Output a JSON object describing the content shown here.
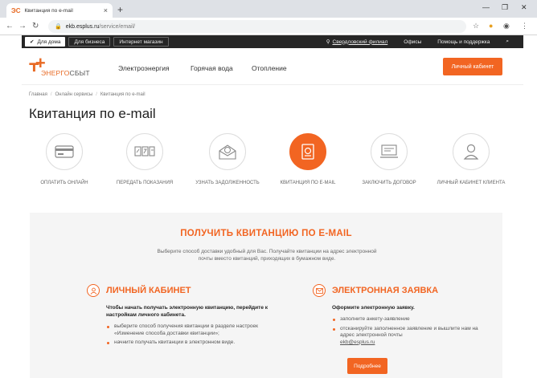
{
  "browser": {
    "tab_title": "Квитанция по e-mail",
    "tab_favicon": "ЭС",
    "url_host": "ekb.esplus.ru",
    "url_path": "/service/email/"
  },
  "topbar": {
    "home": "Для дома",
    "business": "Для бизнеса",
    "shop": "Интернет магазин",
    "branch": "Свердловский филиал",
    "offices": "Офисы",
    "help": "Помощь и поддержка"
  },
  "header": {
    "logo_prefix": "ЭНЕРГО",
    "logo_suffix": "СБЫТ",
    "nav": [
      "Электроэнергия",
      "Горячая вода",
      "Отопление"
    ],
    "cabinet_button": "Личный кабинет"
  },
  "breadcrumbs": [
    "Главная",
    "Онлайн сервисы",
    "Квитанция по e-mail"
  ],
  "page_title": "Квитанция по e-mail",
  "services": [
    {
      "label": "Оплатить онлайн",
      "icon": "card-icon",
      "active": false
    },
    {
      "label": "Передать показания",
      "icon": "meter-icon",
      "active": false
    },
    {
      "label": "Узнать задолженность",
      "icon": "debt-envelope-icon",
      "active": false
    },
    {
      "label": "Квитанция по e-mail",
      "icon": "email-receipt-icon",
      "active": true
    },
    {
      "label": "Заключить договор",
      "icon": "contract-icon",
      "active": false
    },
    {
      "label": "Личный кабинет клиента",
      "icon": "user-icon",
      "active": false
    }
  ],
  "panel": {
    "title": "ПОЛУЧИТЬ КВИТАНЦИЮ ПО E-MAIL",
    "description": "Выберите способ доставки удобный для Вас. Получайте квитанции на адрес электронной почты вместо квитанций, приходящих в бумажном виде.",
    "left": {
      "title": "Личный кабинет",
      "subtitle": "Чтобы начать получать электронную квитанцию, перейдите к настройкам личного кабинета.",
      "items": [
        "выберите способ получения квитанции в разделе настроек «Изменение способа доставки квитанции»;",
        "начните получать квитанции в электронном виде."
      ]
    },
    "right": {
      "title": "Электронная заявка",
      "subtitle": "Оформите электронную заявку.",
      "items": [
        "заполните анкету-заявление",
        "отсканируйте заполненное заявление и вышлите нам на адрес электронной почты"
      ],
      "email": "ekb@esplus.ru",
      "button": "Подробнее"
    }
  },
  "colors": {
    "accent": "#f26522",
    "topbar": "#262626"
  }
}
